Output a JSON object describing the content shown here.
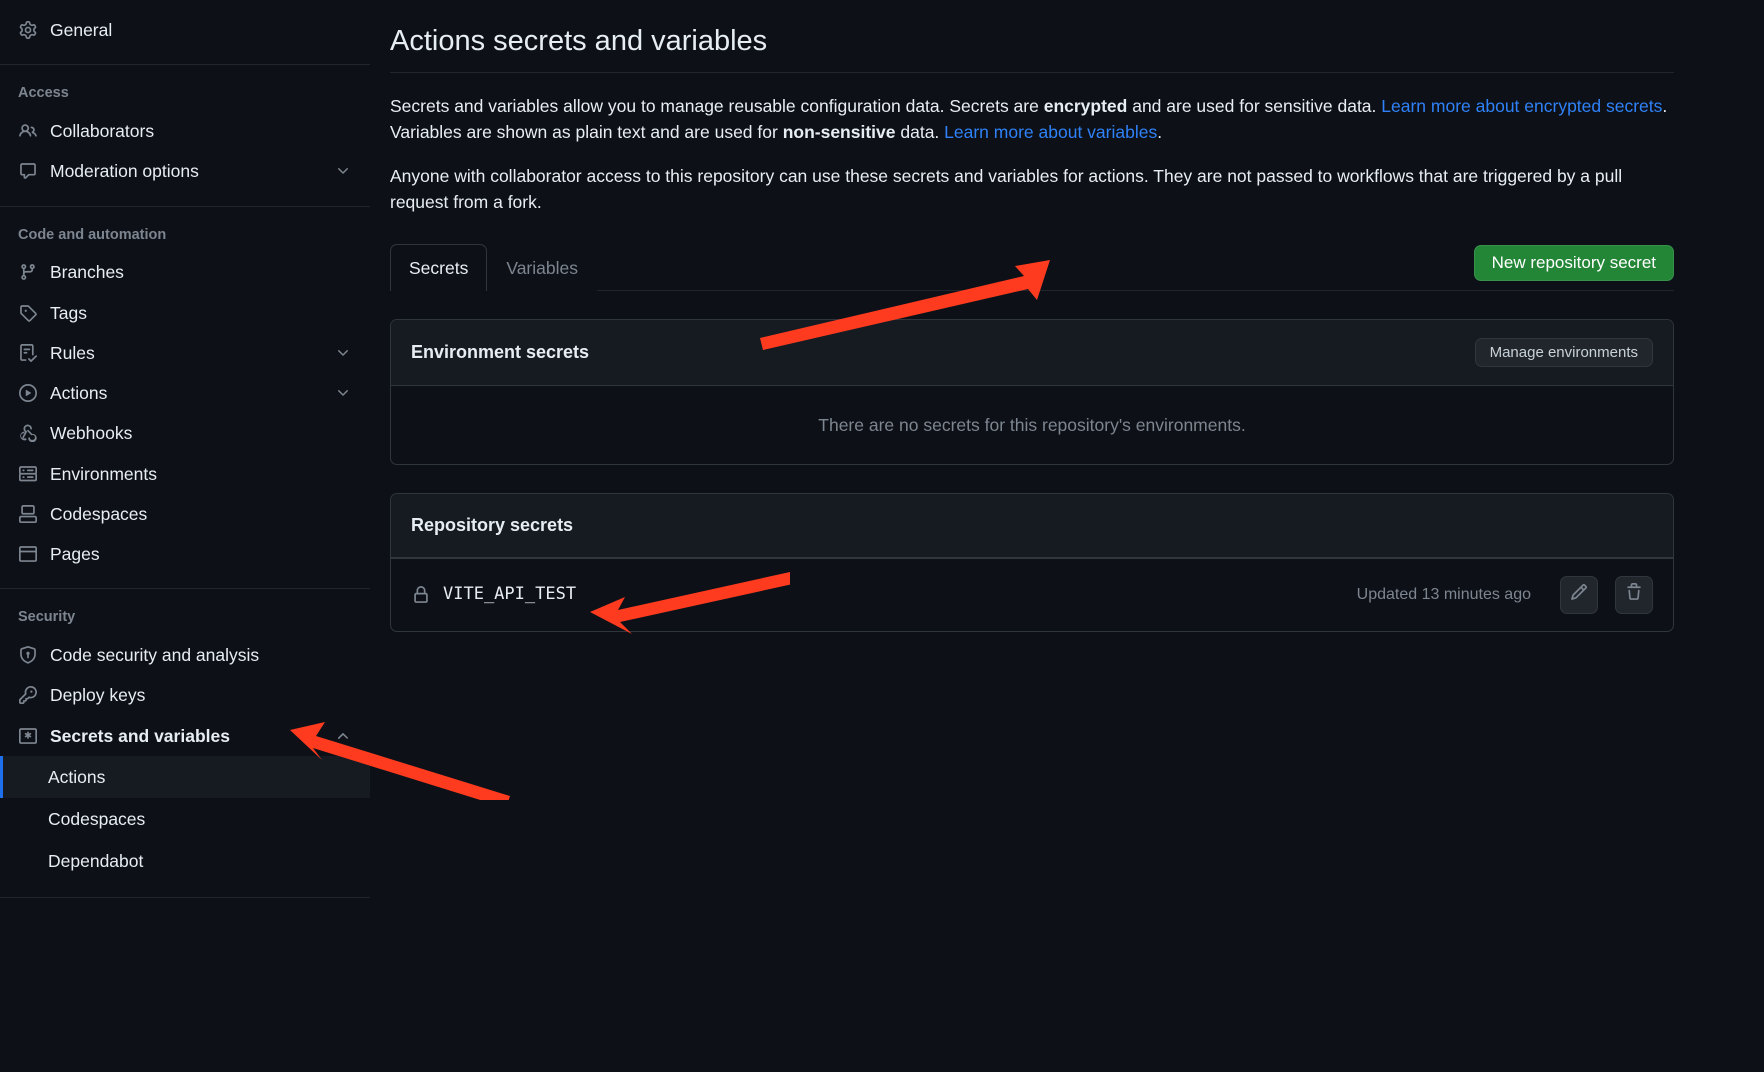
{
  "sidebar": {
    "general": "General",
    "access": {
      "heading": "Access",
      "collaborators": "Collaborators",
      "moderation": "Moderation options"
    },
    "code": {
      "heading": "Code and automation",
      "branches": "Branches",
      "tags": "Tags",
      "rules": "Rules",
      "actions": "Actions",
      "webhooks": "Webhooks",
      "environments": "Environments",
      "codespaces": "Codespaces",
      "pages": "Pages"
    },
    "security": {
      "heading": "Security",
      "code_security": "Code security and analysis",
      "deploy_keys": "Deploy keys",
      "secrets_vars": "Secrets and variables",
      "sub_actions": "Actions",
      "sub_codespaces": "Codespaces",
      "sub_dependabot": "Dependabot"
    }
  },
  "page": {
    "title": "Actions secrets and variables",
    "desc1_a": "Secrets and variables allow you to manage reusable configuration data. Secrets are ",
    "desc1_b": "encrypted",
    "desc1_c": " and are used for sensitive data. ",
    "link1": "Learn more about encrypted secrets",
    "desc1_d": ". Variables are shown as plain text and are used for ",
    "desc1_e": "non-sensitive",
    "desc1_f": " data. ",
    "link2": "Learn more about variables",
    "desc1_g": ".",
    "desc2": "Anyone with collaborator access to this repository can use these secrets and variables for actions. They are not passed to workflows that are triggered by a pull request from a fork.",
    "tab_secrets": "Secrets",
    "tab_variables": "Variables",
    "btn_new": "New repository secret",
    "env_title": "Environment secrets",
    "btn_manage_env": "Manage environments",
    "env_empty": "There are no secrets for this repository's environments.",
    "repo_title": "Repository secrets",
    "secret_name": "VITE_API_TEST",
    "secret_updated": "Updated 13 minutes ago"
  }
}
